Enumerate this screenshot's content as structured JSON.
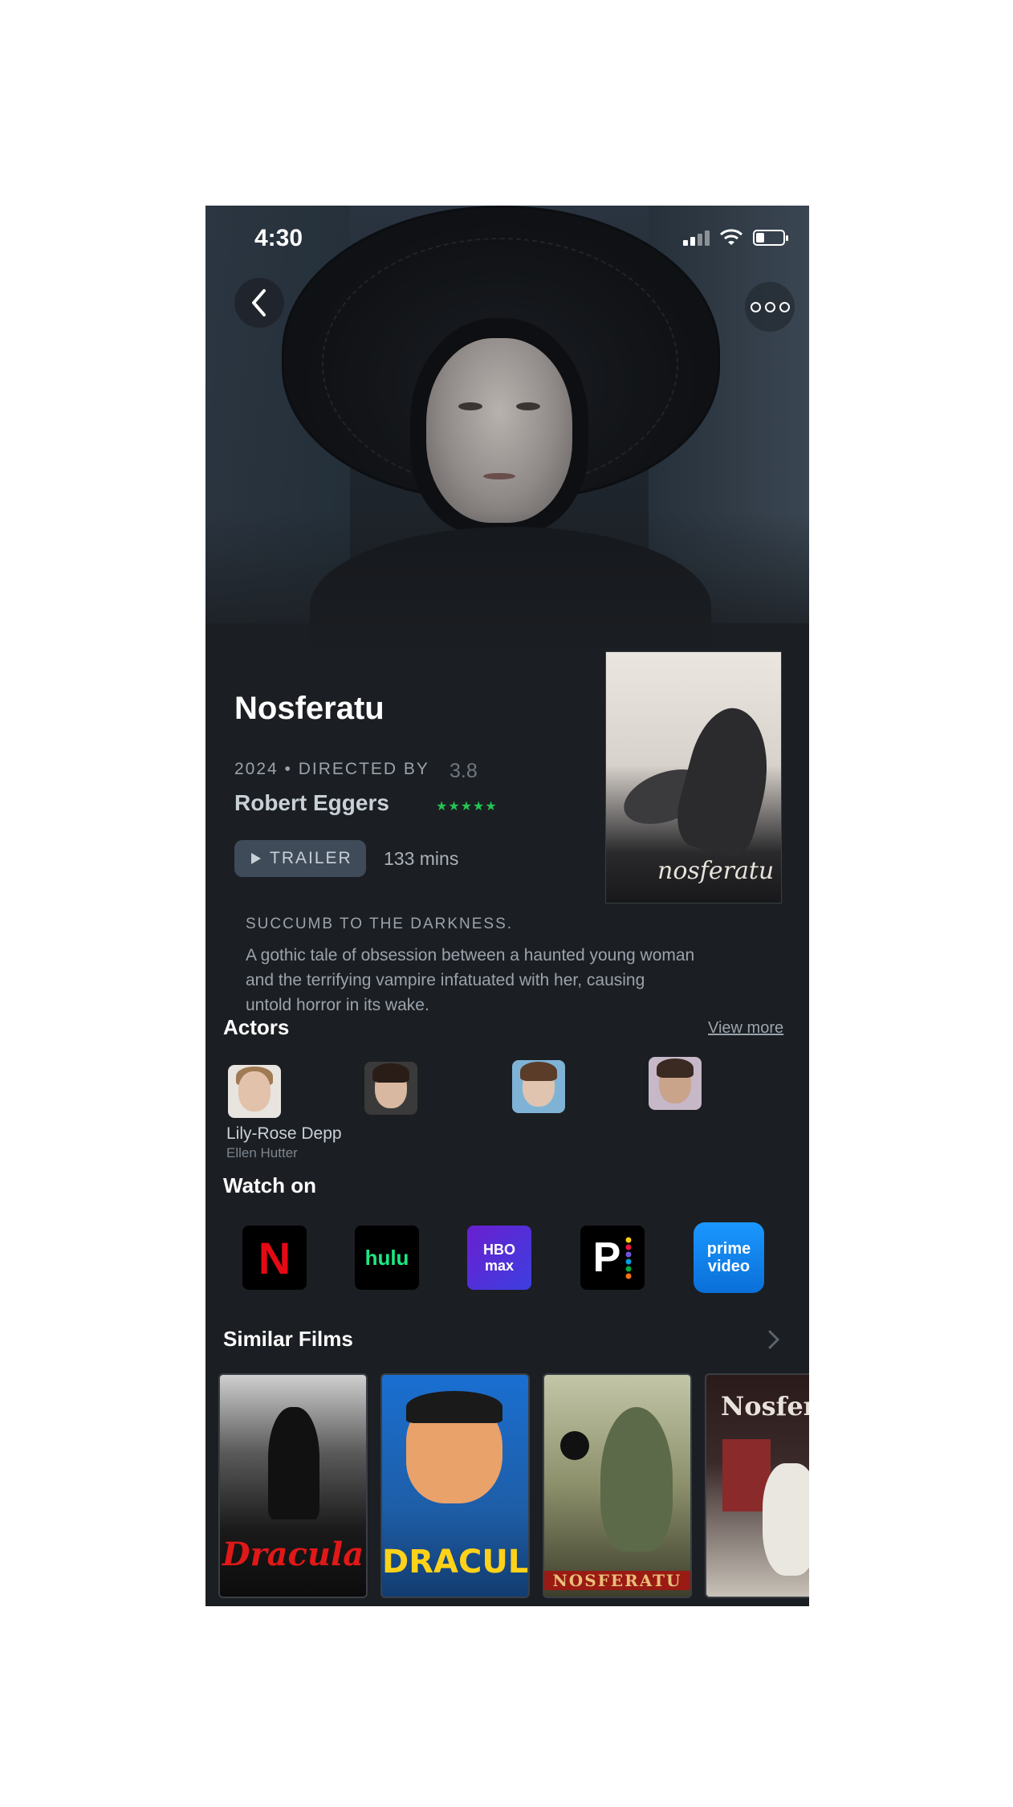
{
  "status_bar": {
    "time": "4:30"
  },
  "film": {
    "title": "Nosferatu",
    "meta": "2024 • DIRECTED BY",
    "director": "Robert Eggers",
    "rating": "3.8",
    "stars": "★★★★★",
    "trailer_label": "TRAILER",
    "runtime": "133 mins",
    "poster_title": "nosferatu",
    "tagline": "SUCCUMB TO THE DARKNESS.",
    "synopsis": "A gothic tale of obsession between a haunted young woman and the terrifying vampire infatuated with her, causing untold horror in its wake."
  },
  "actors": {
    "title": "Actors",
    "view_more": "View more",
    "first_name": "Lily-Rose Depp",
    "first_role": "Ellen Hutter"
  },
  "watch_on": {
    "title": "Watch on",
    "services": [
      "N",
      "hulu",
      "HBO max",
      "P",
      "prime video"
    ]
  },
  "similar_films": {
    "title": "Similar Films",
    "films": [
      "Dracula",
      "DRACULA",
      "NOSFERATU",
      "Nosfera"
    ]
  },
  "colors": {
    "background": "#1b1e22",
    "star_green": "#23c552",
    "trailer_bg": "#3f4b58"
  }
}
